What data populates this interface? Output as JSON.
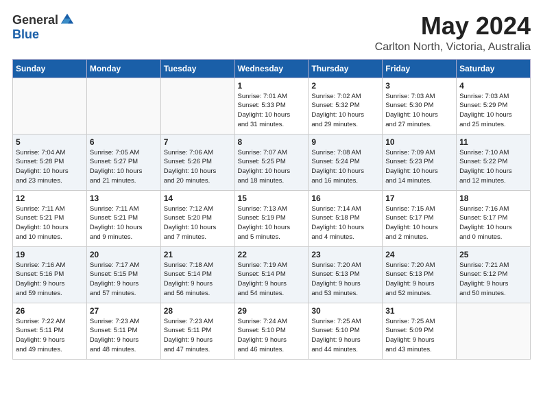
{
  "header": {
    "logo_general": "General",
    "logo_blue": "Blue",
    "month_title": "May 2024",
    "location": "Carlton North, Victoria, Australia"
  },
  "weekdays": [
    "Sunday",
    "Monday",
    "Tuesday",
    "Wednesday",
    "Thursday",
    "Friday",
    "Saturday"
  ],
  "weeks": [
    [
      {
        "day": "",
        "info": ""
      },
      {
        "day": "",
        "info": ""
      },
      {
        "day": "",
        "info": ""
      },
      {
        "day": "1",
        "info": "Sunrise: 7:01 AM\nSunset: 5:33 PM\nDaylight: 10 hours\nand 31 minutes."
      },
      {
        "day": "2",
        "info": "Sunrise: 7:02 AM\nSunset: 5:32 PM\nDaylight: 10 hours\nand 29 minutes."
      },
      {
        "day": "3",
        "info": "Sunrise: 7:03 AM\nSunset: 5:30 PM\nDaylight: 10 hours\nand 27 minutes."
      },
      {
        "day": "4",
        "info": "Sunrise: 7:03 AM\nSunset: 5:29 PM\nDaylight: 10 hours\nand 25 minutes."
      }
    ],
    [
      {
        "day": "5",
        "info": "Sunrise: 7:04 AM\nSunset: 5:28 PM\nDaylight: 10 hours\nand 23 minutes."
      },
      {
        "day": "6",
        "info": "Sunrise: 7:05 AM\nSunset: 5:27 PM\nDaylight: 10 hours\nand 21 minutes."
      },
      {
        "day": "7",
        "info": "Sunrise: 7:06 AM\nSunset: 5:26 PM\nDaylight: 10 hours\nand 20 minutes."
      },
      {
        "day": "8",
        "info": "Sunrise: 7:07 AM\nSunset: 5:25 PM\nDaylight: 10 hours\nand 18 minutes."
      },
      {
        "day": "9",
        "info": "Sunrise: 7:08 AM\nSunset: 5:24 PM\nDaylight: 10 hours\nand 16 minutes."
      },
      {
        "day": "10",
        "info": "Sunrise: 7:09 AM\nSunset: 5:23 PM\nDaylight: 10 hours\nand 14 minutes."
      },
      {
        "day": "11",
        "info": "Sunrise: 7:10 AM\nSunset: 5:22 PM\nDaylight: 10 hours\nand 12 minutes."
      }
    ],
    [
      {
        "day": "12",
        "info": "Sunrise: 7:11 AM\nSunset: 5:21 PM\nDaylight: 10 hours\nand 10 minutes."
      },
      {
        "day": "13",
        "info": "Sunrise: 7:11 AM\nSunset: 5:21 PM\nDaylight: 10 hours\nand 9 minutes."
      },
      {
        "day": "14",
        "info": "Sunrise: 7:12 AM\nSunset: 5:20 PM\nDaylight: 10 hours\nand 7 minutes."
      },
      {
        "day": "15",
        "info": "Sunrise: 7:13 AM\nSunset: 5:19 PM\nDaylight: 10 hours\nand 5 minutes."
      },
      {
        "day": "16",
        "info": "Sunrise: 7:14 AM\nSunset: 5:18 PM\nDaylight: 10 hours\nand 4 minutes."
      },
      {
        "day": "17",
        "info": "Sunrise: 7:15 AM\nSunset: 5:17 PM\nDaylight: 10 hours\nand 2 minutes."
      },
      {
        "day": "18",
        "info": "Sunrise: 7:16 AM\nSunset: 5:17 PM\nDaylight: 10 hours\nand 0 minutes."
      }
    ],
    [
      {
        "day": "19",
        "info": "Sunrise: 7:16 AM\nSunset: 5:16 PM\nDaylight: 9 hours\nand 59 minutes."
      },
      {
        "day": "20",
        "info": "Sunrise: 7:17 AM\nSunset: 5:15 PM\nDaylight: 9 hours\nand 57 minutes."
      },
      {
        "day": "21",
        "info": "Sunrise: 7:18 AM\nSunset: 5:14 PM\nDaylight: 9 hours\nand 56 minutes."
      },
      {
        "day": "22",
        "info": "Sunrise: 7:19 AM\nSunset: 5:14 PM\nDaylight: 9 hours\nand 54 minutes."
      },
      {
        "day": "23",
        "info": "Sunrise: 7:20 AM\nSunset: 5:13 PM\nDaylight: 9 hours\nand 53 minutes."
      },
      {
        "day": "24",
        "info": "Sunrise: 7:20 AM\nSunset: 5:13 PM\nDaylight: 9 hours\nand 52 minutes."
      },
      {
        "day": "25",
        "info": "Sunrise: 7:21 AM\nSunset: 5:12 PM\nDaylight: 9 hours\nand 50 minutes."
      }
    ],
    [
      {
        "day": "26",
        "info": "Sunrise: 7:22 AM\nSunset: 5:11 PM\nDaylight: 9 hours\nand 49 minutes."
      },
      {
        "day": "27",
        "info": "Sunrise: 7:23 AM\nSunset: 5:11 PM\nDaylight: 9 hours\nand 48 minutes."
      },
      {
        "day": "28",
        "info": "Sunrise: 7:23 AM\nSunset: 5:11 PM\nDaylight: 9 hours\nand 47 minutes."
      },
      {
        "day": "29",
        "info": "Sunrise: 7:24 AM\nSunset: 5:10 PM\nDaylight: 9 hours\nand 46 minutes."
      },
      {
        "day": "30",
        "info": "Sunrise: 7:25 AM\nSunset: 5:10 PM\nDaylight: 9 hours\nand 44 minutes."
      },
      {
        "day": "31",
        "info": "Sunrise: 7:25 AM\nSunset: 5:09 PM\nDaylight: 9 hours\nand 43 minutes."
      },
      {
        "day": "",
        "info": ""
      }
    ]
  ]
}
